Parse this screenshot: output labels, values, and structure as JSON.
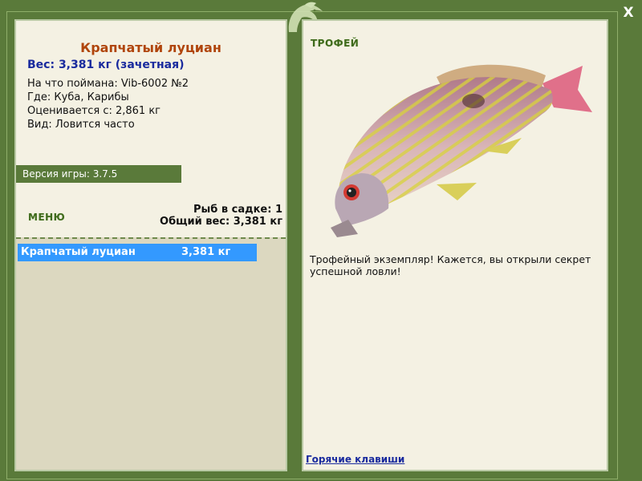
{
  "window": {
    "close_label": "X",
    "logo_icon": "leaping-fish-logo-icon"
  },
  "fish": {
    "name": "Крапчатый луциан",
    "weight_line": "Вес: 3,381 кг (зачетная)",
    "caught_with": "На что поймана: Vib-6002 №2",
    "where": "Где: Куба, Карибы",
    "valued_from": "Оценивается с: 2,861 кг",
    "kind": "Вид: Ловится часто"
  },
  "version": "Версия игры: 3.7.5",
  "menu_label": "МЕНЮ",
  "keep": {
    "count_line": "Рыб в садке: 1",
    "total_weight_line": "Общий вес: 3,381 кг",
    "rows": [
      {
        "name": "Крапчатый луциан",
        "weight": "3,381 кг"
      }
    ]
  },
  "trophy": {
    "label": "ТРОФЕЙ",
    "message": "Трофейный экземпляр! Кажется, вы открыли секрет успешной ловли!",
    "image_icon": "snapper-fish-photo"
  },
  "hotkeys_link": "Горячие клавиши",
  "colors": {
    "frame": "#5a7a3a",
    "panel": "#f4f1e3",
    "title": "#b0450c",
    "weight": "#1a2b9e",
    "selection": "#3399ff"
  }
}
